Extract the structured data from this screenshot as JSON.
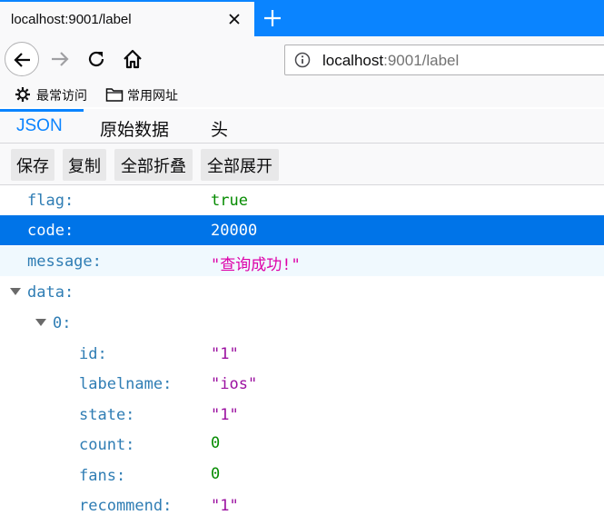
{
  "browser": {
    "tab_title": "localhost:9001/label",
    "url_host": "localhost",
    "url_rest": ":9001/label",
    "bookmarks": [
      {
        "label": "最常访问",
        "icon": "gear-icon"
      },
      {
        "label": "常用网址",
        "icon": "folder-icon"
      }
    ]
  },
  "viewer": {
    "tabs": [
      {
        "label": "JSON",
        "active": true
      },
      {
        "label": "原始数据",
        "active": false
      },
      {
        "label": "头",
        "active": false
      }
    ],
    "toolbar": {
      "save": "保存",
      "copy": "复制",
      "collapse_all": "全部折叠",
      "expand_all": "全部展开"
    }
  },
  "json_rows": {
    "flag": {
      "key": "flag:",
      "value": "true"
    },
    "code": {
      "key": "code:",
      "value": "20000"
    },
    "message": {
      "key": "message:",
      "value": "\"查询成功!\""
    },
    "data": {
      "key": "data:"
    },
    "item0": {
      "key": "0:"
    },
    "id": {
      "key": "id:",
      "value": "\"1\""
    },
    "labelname": {
      "key": "labelname:",
      "value": "\"ios\""
    },
    "state": {
      "key": "state:",
      "value": "\"1\""
    },
    "count": {
      "key": "count:",
      "value": "0"
    },
    "fans": {
      "key": "fans:",
      "value": "0"
    },
    "recommend": {
      "key": "recommend:",
      "value": "\"1\""
    }
  },
  "colors": {
    "accent": "#0a84ff",
    "selected_row": "#0074e8",
    "key": "#2f7db4",
    "string": "#dd00a9",
    "number": "#058b00"
  }
}
